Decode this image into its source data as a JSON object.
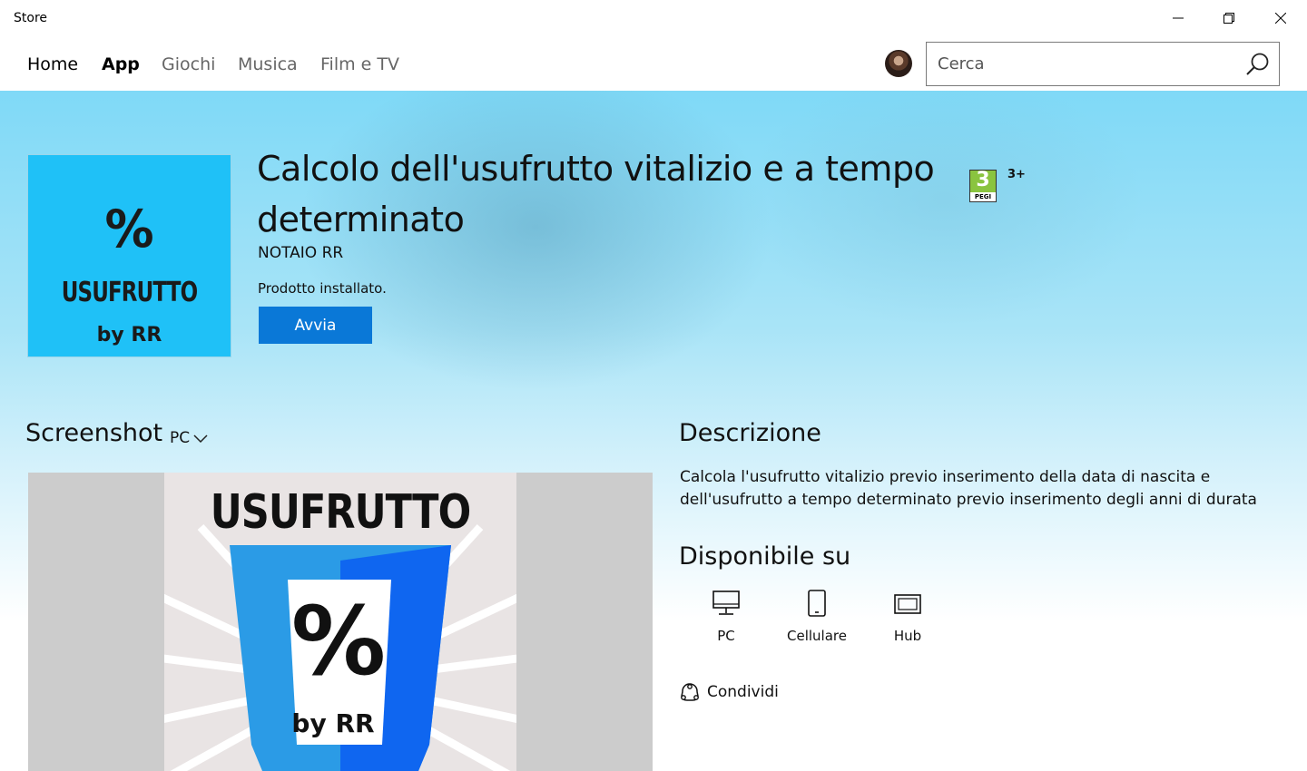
{
  "window": {
    "title": "Store"
  },
  "nav": {
    "items": [
      {
        "label": "Home"
      },
      {
        "label": "App"
      },
      {
        "label": "Giochi"
      },
      {
        "label": "Musica"
      },
      {
        "label": "Film e TV"
      }
    ],
    "active": "App",
    "search_placeholder": "Cerca"
  },
  "app": {
    "title": "Calcolo dell'usufrutto vitalizio e a tempo determinato",
    "publisher": "NOTAIO RR",
    "status": "Prodotto installato.",
    "launch_label": "Avvia",
    "rating": {
      "pegi_number": "3",
      "pegi_text": "PEGI",
      "label": "3+"
    },
    "logo": {
      "symbol": "%",
      "word": "USUFRUTTO",
      "by": "by RR",
      "bg_color": "#1fc1f7"
    }
  },
  "screenshots": {
    "title": "Screenshot",
    "platform": "PC",
    "image": {
      "word": "USUFRUTTO",
      "symbol": "%",
      "by": "by RR"
    }
  },
  "description": {
    "title": "Descrizione",
    "text": "Calcola l'usufrutto vitalizio previo inserimento della data di nascita e dell'usufrutto a tempo determinato previo inserimento degli anni di durata"
  },
  "availability": {
    "title": "Disponibile su",
    "devices": [
      {
        "label": "PC",
        "icon": "pc-icon"
      },
      {
        "label": "Cellulare",
        "icon": "phone-icon"
      },
      {
        "label": "Hub",
        "icon": "hub-icon"
      }
    ]
  },
  "share": {
    "label": "Condividi"
  },
  "colors": {
    "accent": "#0a78d7",
    "pegi_green": "#8ac43f"
  }
}
